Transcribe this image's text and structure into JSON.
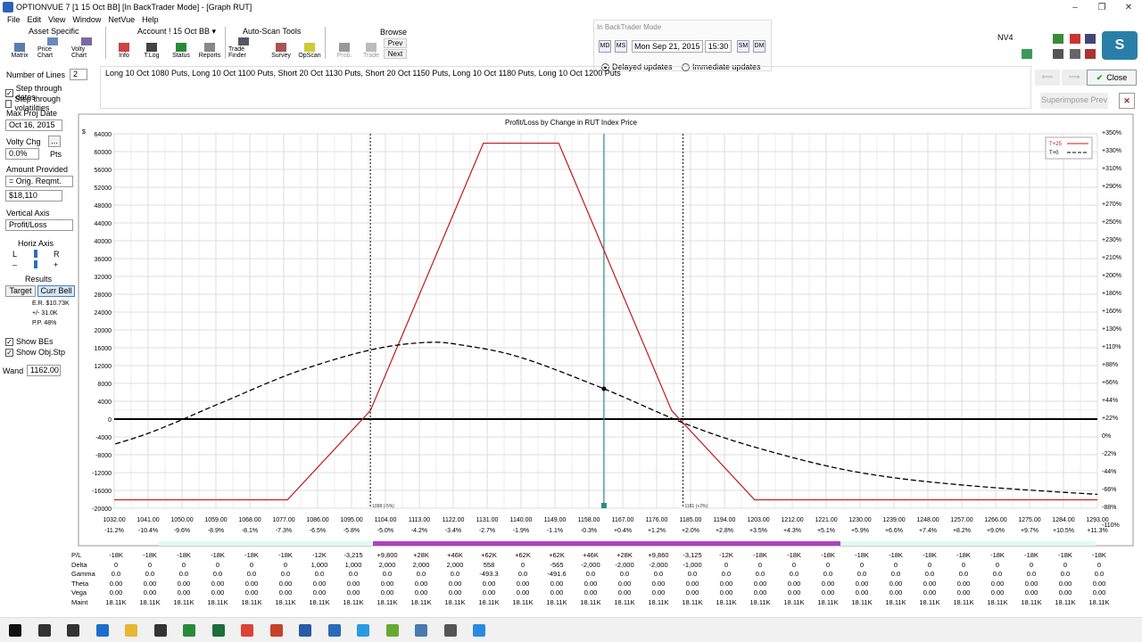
{
  "window": {
    "title": "OPTIONVUE 7   [1 15 Oct BB]   [In BackTrader Mode] - [Graph RUT]",
    "controls": [
      "–",
      "❐",
      "✕"
    ]
  },
  "menu": [
    "File",
    "Edit",
    "View",
    "Window",
    "NetVue",
    "Help"
  ],
  "toolbar": {
    "groups": {
      "asset": "Asset Specific",
      "account": "Account ! 15 Oct BB ▾",
      "autoscan": "Auto-Scan Tools",
      "browse": "Browse"
    },
    "buttons": [
      {
        "label": "Matrix",
        "icon": "matrix-icon"
      },
      {
        "label": "Price Chart",
        "icon": "price-chart-icon"
      },
      {
        "label": "Volty Chart",
        "icon": "volty-chart-icon"
      },
      {
        "label": "Info",
        "icon": "info-icon"
      },
      {
        "label": "T.Log",
        "icon": "tlog-icon"
      },
      {
        "label": "Status",
        "icon": "status-icon"
      },
      {
        "label": "Reports",
        "icon": "reports-icon"
      },
      {
        "label": "Trade Finder",
        "icon": "trade-finder-icon"
      },
      {
        "label": "Survey",
        "icon": "survey-icon"
      },
      {
        "label": "OpScan",
        "icon": "opscan-icon"
      },
      {
        "label": "Prob.",
        "icon": "prob-icon"
      },
      {
        "label": "Trade",
        "icon": "trade-icon"
      }
    ],
    "browse_prev": "Prev",
    "browse_next": "Next"
  },
  "backtrader": {
    "header": "In BackTrader Mode",
    "md": "MD",
    "ms": "MS",
    "date": "Mon Sep 21, 2015",
    "time": "15:30",
    "sm": "SM",
    "dm": "DM",
    "delayed": "Delayed updates",
    "immediate": "Immediate updates"
  },
  "right_header": {
    "nv": "NV4",
    "avatar": "S",
    "close": "Close",
    "superimpose": "Superimpose Prev"
  },
  "left": {
    "num_lines_label": "Number of Lines",
    "num_lines_value": "2",
    "step_dates": "Step through dates",
    "step_vols": "Step through volatilities",
    "max_proj_label": "Max Proj Date",
    "max_proj_value": "Oct 16, 2015",
    "volty_chg_label": "Volty Chg",
    "volty_chg_value": "0.0%",
    "pts": "Pts",
    "amount_label": "Amount Provided",
    "amount_select": "= Orig. Reqmt.",
    "amount_value": "$18,110",
    "vaxis_label": "Vertical Axis",
    "vaxis_value": "Profit/Loss",
    "haxis_label": "Horiz Axis",
    "l": "L",
    "r": "R",
    "minus": "–",
    "plus": "+",
    "results_label": "Results",
    "target": "Target",
    "curr_bell": "Curr Bell",
    "er": "E.R.  $10.73K",
    "pm": "+/-     31.0K",
    "pp": "P.P.       48%",
    "show_bes": "Show BEs",
    "show_obj": "Show Obj.Stp",
    "wand_label": "Wand",
    "wand_value": "1162.00"
  },
  "positions": "Long 10 Oct 1080 Puts, Long 10 Oct 1100 Puts, Short 20 Oct 1130 Puts, Short 20 Oct 1150 Puts, Long 10 Oct 1180 Puts, Long 10 Oct 1200 Puts",
  "chart_data": {
    "type": "line",
    "title": "Profit/Loss by Change in RUT Index Price",
    "ylabel_left": "$",
    "ylim": [
      -20000,
      64000
    ],
    "yticks": [
      "64000",
      "60000",
      "56000",
      "52000",
      "48000",
      "44000",
      "40000",
      "36000",
      "32000",
      "28000",
      "24000",
      "20000",
      "16000",
      "12000",
      "8000",
      "4000",
      "0",
      "-4000",
      "-8000",
      "-12000",
      "-16000",
      "-20000"
    ],
    "yticks_right": [
      "+350%",
      "+330%",
      "+310%",
      "+290%",
      "+270%",
      "+250%",
      "+230%",
      "+210%",
      "+200%",
      "+180%",
      "+160%",
      "+130%",
      "+110%",
      "+88%",
      "+66%",
      "+44%",
      "+22%",
      "0%",
      "-22%",
      "-44%",
      "-66%",
      "-88%",
      "-110%"
    ],
    "xticks": [
      "1032.00",
      "1041.00",
      "1050.00",
      "1059.00",
      "1068.00",
      "1077.00",
      "1086.00",
      "1095.00",
      "1104.00",
      "1113.00",
      "1122.00",
      "1131.00",
      "1140.00",
      "1149.00",
      "1158.00",
      "1167.00",
      "1176.00",
      "1185.00",
      "1194.00",
      "1203.00",
      "1212.00",
      "1221.00",
      "1230.00",
      "1239.00",
      "1248.00",
      "1257.00",
      "1266.00",
      "1275.00",
      "1284.00",
      "1293.00"
    ],
    "xticks_pct": [
      "-11.2%",
      "-10.4%",
      "-9.6%",
      "-8.9%",
      "-8.1%",
      "-7.3%",
      "-6.5%",
      "-5.8%",
      "-5.0%",
      "-4.2%",
      "-3.4%",
      "-2.7%",
      "-1.9%",
      "-1.1%",
      "-0.3%",
      "+0.4%",
      "+1.2%",
      "+2.0%",
      "+2.8%",
      "+3.5%",
      "+4.3%",
      "+5.1%",
      "+5.9%",
      "+6.6%",
      "+7.4%",
      "+8.2%",
      "+9.0%",
      "+9.7%",
      "+10.5%",
      "+11.3%"
    ],
    "xlim": [
      1032,
      1293
    ],
    "series": [
      {
        "name": "T+25",
        "color": "#c0181c",
        "style": "solid",
        "x": [
          1020,
          1078,
          1100,
          1130,
          1150,
          1180,
          1202,
          1305
        ],
        "y": [
          -18110,
          -18110,
          1890,
          61890,
          61890,
          1890,
          -18110,
          -18110
        ]
      },
      {
        "name": "T+0",
        "color": "#000000",
        "style": "dashed",
        "x": [
          1020,
          1040,
          1060,
          1080,
          1100,
          1115,
          1125,
          1140,
          1162,
          1185,
          1205,
          1230,
          1260,
          1305
        ],
        "y": [
          -8500,
          -3500,
          3500,
          10500,
          15500,
          17200,
          16500,
          13800,
          6800,
          -1500,
          -7000,
          -12000,
          -15000,
          -17500
        ]
      }
    ],
    "breakeven_x": [
      1100,
      1183
    ],
    "be_labels": [
      "1098 (-5%)",
      "1181 (+2%)"
    ],
    "current_price": 1162,
    "legend": "top-right"
  },
  "table": {
    "rows": [
      {
        "label": "P/L",
        "values": [
          "-18K",
          "-18K",
          "-18K",
          "-18K",
          "-18K",
          "-18K",
          "-12K",
          "-3,215",
          "+9,800",
          "+28K",
          "+46K",
          "+62K",
          "+62K",
          "+62K",
          "+46K",
          "+28K",
          "+9,860",
          "-3,125",
          "-12K",
          "-18K",
          "-18K",
          "-18K",
          "-18K",
          "-18K",
          "-18K",
          "-18K",
          "-18K",
          "-18K",
          "-18K",
          "-18K"
        ]
      },
      {
        "label": "Delta",
        "values": [
          "0",
          "0",
          "0",
          "0",
          "0",
          "0",
          "1,000",
          "1,000",
          "2,000",
          "2,000",
          "2,000",
          "558",
          "0",
          "-565",
          "-2,000",
          "-2,000",
          "-2,000",
          "-1,000",
          "0",
          "0",
          "0",
          "0",
          "0",
          "0",
          "0",
          "0",
          "0",
          "0",
          "0",
          "0"
        ]
      },
      {
        "label": "Gamma",
        "values": [
          "0.0",
          "0.0",
          "0.0",
          "0.0",
          "0.0",
          "0.0",
          "0.0",
          "0.0",
          "0.0",
          "0.0",
          "0.0",
          "-493.3",
          "0.0",
          "-491.6",
          "0.0",
          "0.0",
          "0.0",
          "0.0",
          "0.0",
          "0.0",
          "0.0",
          "0.0",
          "0.0",
          "0.0",
          "0.0",
          "0.0",
          "0.0",
          "0.0",
          "0.0",
          "0.0"
        ]
      },
      {
        "label": "Theta",
        "values": [
          "0.00",
          "0.00",
          "0.00",
          "0.00",
          "0.00",
          "0.00",
          "0.00",
          "0.00",
          "0.00",
          "0.00",
          "0.00",
          "0.00",
          "0.00",
          "0.00",
          "0.00",
          "0.00",
          "0.00",
          "0.00",
          "0.00",
          "0.00",
          "0.00",
          "0.00",
          "0.00",
          "0.00",
          "0.00",
          "0.00",
          "0.00",
          "0.00",
          "0.00",
          "0.00"
        ]
      },
      {
        "label": "Vega",
        "values": [
          "0.00",
          "0.00",
          "0.00",
          "0.00",
          "0.00",
          "0.00",
          "0.00",
          "0.00",
          "0.00",
          "0.00",
          "0.00",
          "0.00",
          "0.00",
          "0.00",
          "0.00",
          "0.00",
          "0.00",
          "0.00",
          "0.00",
          "0.00",
          "0.00",
          "0.00",
          "0.00",
          "0.00",
          "0.00",
          "0.00",
          "0.00",
          "0.00",
          "0.00",
          "0.00"
        ]
      },
      {
        "label": "Maint",
        "values": [
          "18.11K",
          "18.11K",
          "18.11K",
          "18.11K",
          "18.11K",
          "18.11K",
          "18.11K",
          "18.11K",
          "18.11K",
          "18.11K",
          "18.11K",
          "18.11K",
          "18.11K",
          "18.11K",
          "18.11K",
          "18.11K",
          "18.11K",
          "18.11K",
          "18.11K",
          "18.11K",
          "18.11K",
          "18.11K",
          "18.11K",
          "18.11K",
          "18.11K",
          "18.11K",
          "18.11K",
          "18.11K",
          "18.11K",
          "18.11K"
        ]
      }
    ]
  },
  "taskbar": {
    "icons": [
      "start-icon",
      "search-icon",
      "taskview-icon",
      "edge-icon",
      "explorer-icon",
      "store-icon",
      "excel-green-icon",
      "excel-icon",
      "chrome-icon",
      "powerpoint-icon",
      "word-icon",
      "outlook-icon",
      "skype-icon",
      "app-icon",
      "app2-icon",
      "settings-icon",
      "snowflake-icon"
    ]
  }
}
